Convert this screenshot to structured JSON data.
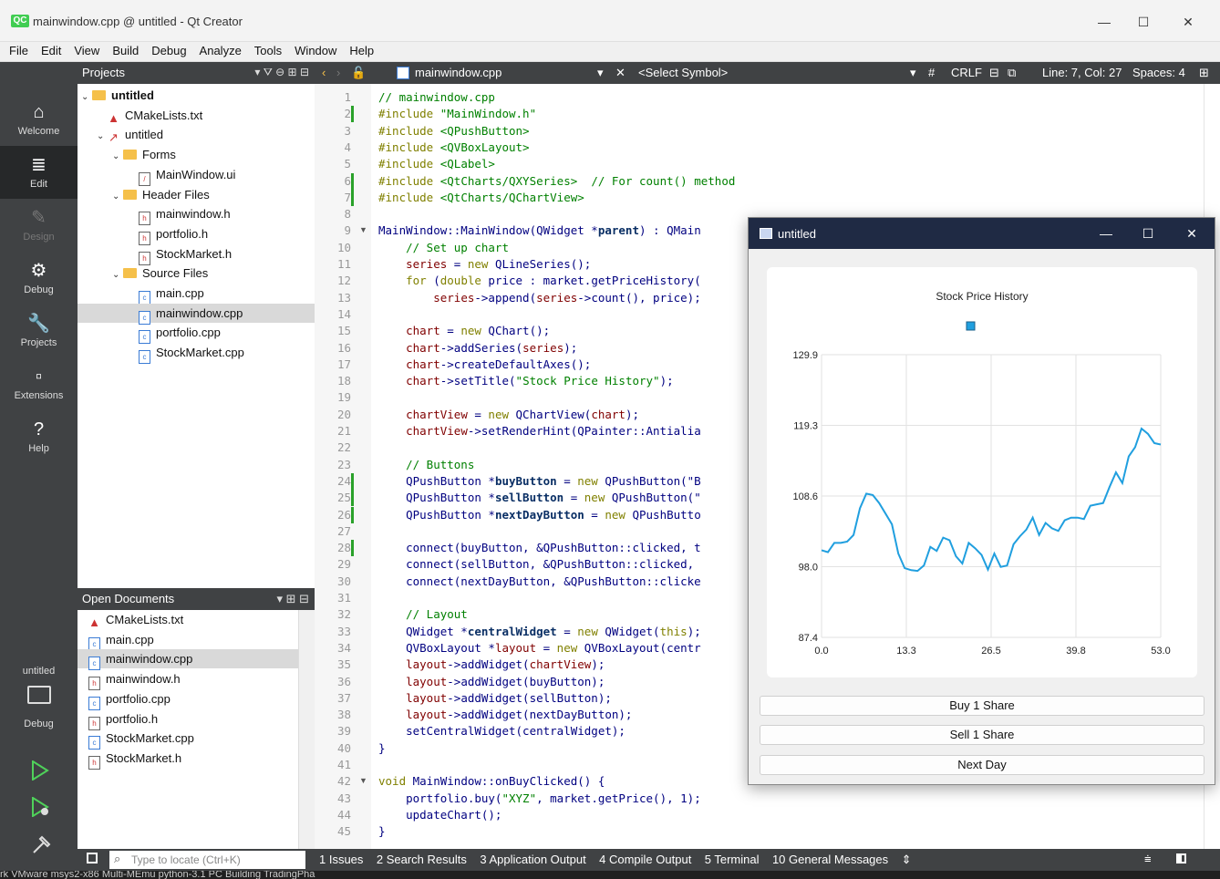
{
  "window": {
    "title": "mainwindow.cpp @ untitled - Qt Creator",
    "logo": "QC",
    "controls": [
      "—",
      "☐",
      "✕"
    ]
  },
  "menu": [
    "File",
    "Edit",
    "View",
    "Build",
    "Debug",
    "Analyze",
    "Tools",
    "Window",
    "Help"
  ],
  "modes": [
    {
      "label": "Welcome",
      "icon": "home-icon",
      "glyph": "⌂"
    },
    {
      "label": "Edit",
      "icon": "edit-icon",
      "glyph": "≣"
    },
    {
      "label": "Design",
      "icon": "design-icon",
      "glyph": "✎"
    },
    {
      "label": "Debug",
      "icon": "debug-icon",
      "glyph": "⚙"
    },
    {
      "label": "Projects",
      "icon": "wrench-icon",
      "glyph": "🔧"
    },
    {
      "label": "Extensions",
      "icon": "extensions-icon",
      "glyph": "▫"
    },
    {
      "label": "Help",
      "icon": "help-icon",
      "glyph": "?"
    }
  ],
  "kit": {
    "project": "untitled",
    "mode": "Debug"
  },
  "projects": {
    "title": "Projects",
    "tree": [
      {
        "label": "untitled",
        "level": 0,
        "kind": "project",
        "bold": true,
        "arrow": "v"
      },
      {
        "label": "CMakeLists.txt",
        "level": 1,
        "kind": "cmake"
      },
      {
        "label": "untitled",
        "level": 1,
        "kind": "target",
        "arrow": "v"
      },
      {
        "label": "Forms",
        "level": 2,
        "kind": "folder",
        "arrow": "v"
      },
      {
        "label": "MainWindow.ui",
        "level": 3,
        "kind": "ui"
      },
      {
        "label": "Header Files",
        "level": 2,
        "kind": "folder",
        "arrow": "v"
      },
      {
        "label": "mainwindow.h",
        "level": 3,
        "kind": "h"
      },
      {
        "label": "portfolio.h",
        "level": 3,
        "kind": "h"
      },
      {
        "label": "StockMarket.h",
        "level": 3,
        "kind": "h"
      },
      {
        "label": "Source Files",
        "level": 2,
        "kind": "folder",
        "arrow": "v"
      },
      {
        "label": "main.cpp",
        "level": 3,
        "kind": "cpp"
      },
      {
        "label": "mainwindow.cpp",
        "level": 3,
        "kind": "cpp",
        "selected": true
      },
      {
        "label": "portfolio.cpp",
        "level": 3,
        "kind": "cpp"
      },
      {
        "label": "StockMarket.cpp",
        "level": 3,
        "kind": "cpp"
      }
    ]
  },
  "open_documents": {
    "title": "Open Documents",
    "items": [
      {
        "label": "CMakeLists.txt",
        "kind": "cmake"
      },
      {
        "label": "main.cpp",
        "kind": "cpp"
      },
      {
        "label": "mainwindow.cpp",
        "kind": "cpp",
        "selected": true
      },
      {
        "label": "mainwindow.h",
        "kind": "h"
      },
      {
        "label": "portfolio.cpp",
        "kind": "cpp"
      },
      {
        "label": "portfolio.h",
        "kind": "h"
      },
      {
        "label": "StockMarket.cpp",
        "kind": "cpp"
      },
      {
        "label": "StockMarket.h",
        "kind": "h"
      }
    ]
  },
  "editor_bar": {
    "file": "mainwindow.cpp",
    "symbol": "<Select Symbol>",
    "hash": "#",
    "line_ending": "CRLF",
    "position": "Line: 7, Col: 27",
    "indent": "Spaces: 4"
  },
  "code": {
    "start_line": 1,
    "changed_lines": [
      2,
      6,
      7,
      24,
      25,
      26,
      28
    ],
    "fold_lines": [
      9,
      42
    ],
    "lines": [
      "// mainwindow.cpp",
      "#include \"MainWindow.h\"",
      "#include <QPushButton>",
      "#include <QVBoxLayout>",
      "#include <QLabel>",
      "#include <QtCharts/QXYSeries>  // For count() method",
      "#include <QtCharts/QChartView>",
      "",
      "MainWindow::MainWindow(QWidget *parent) : QMain",
      "    // Set up chart",
      "    series = new QLineSeries();",
      "    for (double price : market.getPriceHistory(",
      "        series->append(series->count(), price);",
      "",
      "    chart = new QChart();",
      "    chart->addSeries(series);",
      "    chart->createDefaultAxes();",
      "    chart->setTitle(\"Stock Price History\");",
      "",
      "    chartView = new QChartView(chart);",
      "    chartView->setRenderHint(QPainter::Antialia",
      "",
      "    // Buttons",
      "    QPushButton *buyButton = new QPushButton(\"B",
      "    QPushButton *sellButton = new QPushButton(\"",
      "    QPushButton *nextDayButton = new QPushButto",
      "",
      "    connect(buyButton, &QPushButton::clicked, t",
      "    connect(sellButton, &QPushButton::clicked, ",
      "    connect(nextDayButton, &QPushButton::clicke",
      "",
      "    // Layout",
      "    QWidget *centralWidget = new QWidget(this);",
      "    QVBoxLayout *layout = new QVBoxLayout(centr",
      "    layout->addWidget(chartView);",
      "    layout->addWidget(buyButton);",
      "    layout->addWidget(sellButton);",
      "    layout->addWidget(nextDayButton);",
      "    setCentralWidget(centralWidget);",
      "}",
      "",
      "void MainWindow::onBuyClicked() {",
      "    portfolio.buy(\"XYZ\", market.getPrice(), 1);",
      "    updateChart();",
      "}"
    ]
  },
  "bottom": {
    "locate_placeholder": "Type to locate (Ctrl+K)",
    "tabs": [
      "1 Issues",
      "2 Search Results",
      "3 Application Output",
      "4 Compile Output",
      "5 Terminal",
      "10 General Messages"
    ],
    "taskbar": "rk      VMware    msys2-x86    Multi-MEmu  python-3.1      PC Building  TradingPha"
  },
  "app": {
    "title": "untitled",
    "buttons": [
      "Buy 1 Share",
      "Sell 1 Share",
      "Next Day"
    ]
  },
  "chart_data": {
    "type": "line",
    "title": "Stock Price History",
    "xlabel": "",
    "ylabel": "",
    "x_ticks": [
      "0.0",
      "13.3",
      "26.5",
      "39.8",
      "53.0"
    ],
    "y_ticks": [
      "129.9",
      "119.3",
      "108.6",
      "98.0",
      "87.4"
    ],
    "xlim": [
      0,
      53
    ],
    "ylim": [
      87.4,
      129.9
    ],
    "grid": true,
    "legend": "top",
    "color": "#209fdf",
    "series": [
      {
        "x": [
          0,
          1,
          2,
          3,
          4,
          5,
          6,
          7,
          8,
          9,
          10,
          11,
          12,
          13,
          14,
          15,
          16,
          17,
          18,
          19,
          20,
          21,
          22,
          23,
          24,
          25,
          26,
          27,
          28,
          29,
          30,
          31,
          32,
          33,
          34,
          35,
          36,
          37,
          38,
          39,
          40,
          41,
          42,
          43,
          44,
          45,
          46,
          47,
          48,
          49,
          50,
          51,
          52,
          53
        ],
        "values": [
          100.5,
          100.2,
          101.6,
          101.6,
          101.8,
          102.8,
          106.8,
          109.0,
          108.8,
          107.6,
          106.0,
          104.4,
          100.0,
          97.8,
          97.5,
          97.4,
          98.2,
          101.0,
          100.4,
          102.4,
          102.0,
          99.6,
          98.5,
          101.6,
          100.8,
          99.8,
          97.6,
          100.0,
          98.0,
          98.2,
          101.4,
          102.6,
          103.6,
          105.4,
          102.8,
          104.6,
          103.8,
          103.4,
          105.0,
          105.4,
          105.4,
          105.2,
          107.2,
          107.4,
          107.6,
          110.0,
          112.2,
          110.6,
          114.6,
          116.0,
          118.8,
          118.0,
          116.6,
          116.4
        ]
      }
    ]
  }
}
